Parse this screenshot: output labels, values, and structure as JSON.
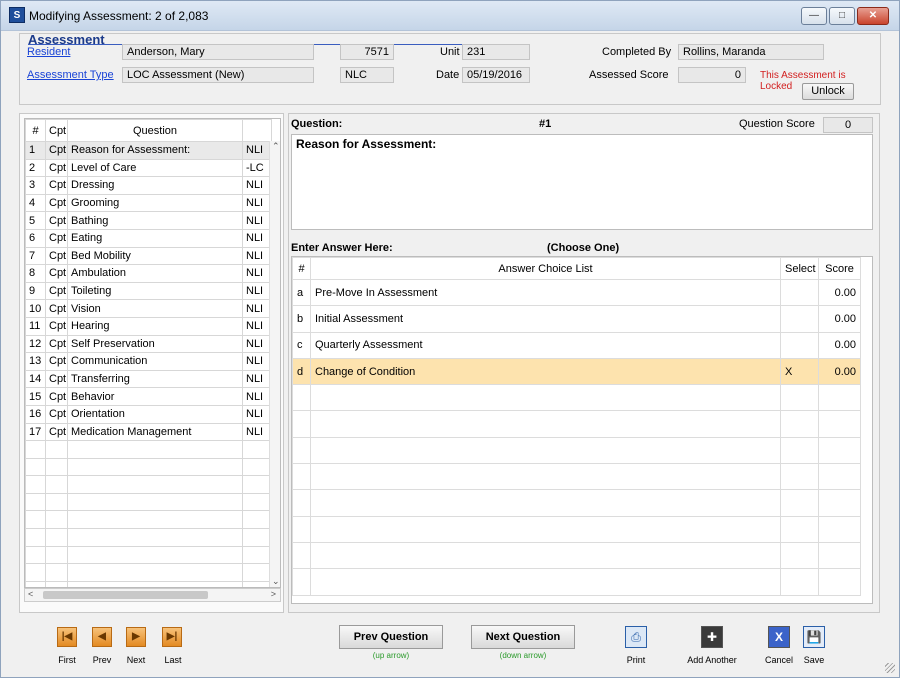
{
  "window": {
    "title": "Modifying Assessment: 2 of 2,083",
    "app_icon": "S"
  },
  "header": {
    "section_title": "Assessment",
    "resident_label": "Resident",
    "resident_value": "Anderson, Mary",
    "resident_id": "7571",
    "unit_label": "Unit",
    "unit_value": "231",
    "completed_by_label": "Completed By",
    "completed_by_value": "Rollins, Maranda",
    "assessment_type_label": "Assessment Type",
    "assessment_type_value": "LOC Assessment (New)",
    "type_code": "NLC",
    "date_label": "Date",
    "date_value": "05/19/2016",
    "assessed_score_label": "Assessed Score",
    "assessed_score_value": "0",
    "locked_text": "This Assessment is Locked",
    "unlock_label": "Unlock"
  },
  "question_list": {
    "columns": [
      "#",
      "Cpt",
      "Question",
      ""
    ],
    "rows": [
      {
        "num": "1",
        "cpt": "Cpt",
        "question": "Reason for Assessment:",
        "code": "NLI"
      },
      {
        "num": "2",
        "cpt": "Cpt",
        "question": "Level of Care",
        "code": "-LC"
      },
      {
        "num": "3",
        "cpt": "Cpt",
        "question": "Dressing",
        "code": "NLI"
      },
      {
        "num": "4",
        "cpt": "Cpt",
        "question": "Grooming",
        "code": "NLI"
      },
      {
        "num": "5",
        "cpt": "Cpt",
        "question": "Bathing",
        "code": "NLI"
      },
      {
        "num": "6",
        "cpt": "Cpt",
        "question": "Eating",
        "code": "NLI"
      },
      {
        "num": "7",
        "cpt": "Cpt",
        "question": "Bed Mobility",
        "code": "NLI"
      },
      {
        "num": "8",
        "cpt": "Cpt",
        "question": "Ambulation",
        "code": "NLI"
      },
      {
        "num": "9",
        "cpt": "Cpt",
        "question": "Toileting",
        "code": "NLI"
      },
      {
        "num": "10",
        "cpt": "Cpt",
        "question": "Vision",
        "code": "NLI"
      },
      {
        "num": "11",
        "cpt": "Cpt",
        "question": "Hearing",
        "code": "NLI"
      },
      {
        "num": "12",
        "cpt": "Cpt",
        "question": "Self Preservation",
        "code": "NLI"
      },
      {
        "num": "13",
        "cpt": "Cpt",
        "question": "Communication",
        "code": "NLI"
      },
      {
        "num": "14",
        "cpt": "Cpt",
        "question": "Transferring",
        "code": "NLI"
      },
      {
        "num": "15",
        "cpt": "Cpt",
        "question": "Behavior",
        "code": "NLI"
      },
      {
        "num": "16",
        "cpt": "Cpt",
        "question": "Orientation",
        "code": "NLI"
      },
      {
        "num": "17",
        "cpt": "Cpt",
        "question": "Medication Management",
        "code": "NLI"
      }
    ],
    "empty_rows": 9
  },
  "question_panel": {
    "question_label": "Question:",
    "question_number": "#1",
    "question_score_label": "Question Score",
    "question_score_value": "0",
    "question_text": "Reason for Assessment:",
    "answer_label": "Enter Answer Here:",
    "choose_hint": "(Choose One)"
  },
  "answers": {
    "columns": [
      "#",
      "Answer Choice List",
      "Select",
      "Score"
    ],
    "rows": [
      {
        "letter": "a",
        "text": "Pre-Move In Assessment",
        "select": "",
        "score": "0.00"
      },
      {
        "letter": "b",
        "text": "Initial Assessment",
        "select": "",
        "score": "0.00"
      },
      {
        "letter": "c",
        "text": "Quarterly Assessment",
        "select": "",
        "score": "0.00"
      },
      {
        "letter": "d",
        "text": "Change of Condition",
        "select": "X",
        "score": "0.00"
      }
    ],
    "empty_rows": 8,
    "highlight_color": "#fde3ae"
  },
  "footer": {
    "first_label": "First",
    "prev_label": "Prev",
    "next_label": "Next",
    "last_label": "Last",
    "prev_question_label": "Prev Question",
    "prev_question_hint": "(up arrow)",
    "next_question_label": "Next Question",
    "next_question_hint": "(down arrow)",
    "print_label": "Print",
    "add_another_label": "Add Another",
    "cancel_label": "Cancel",
    "save_label": "Save"
  }
}
